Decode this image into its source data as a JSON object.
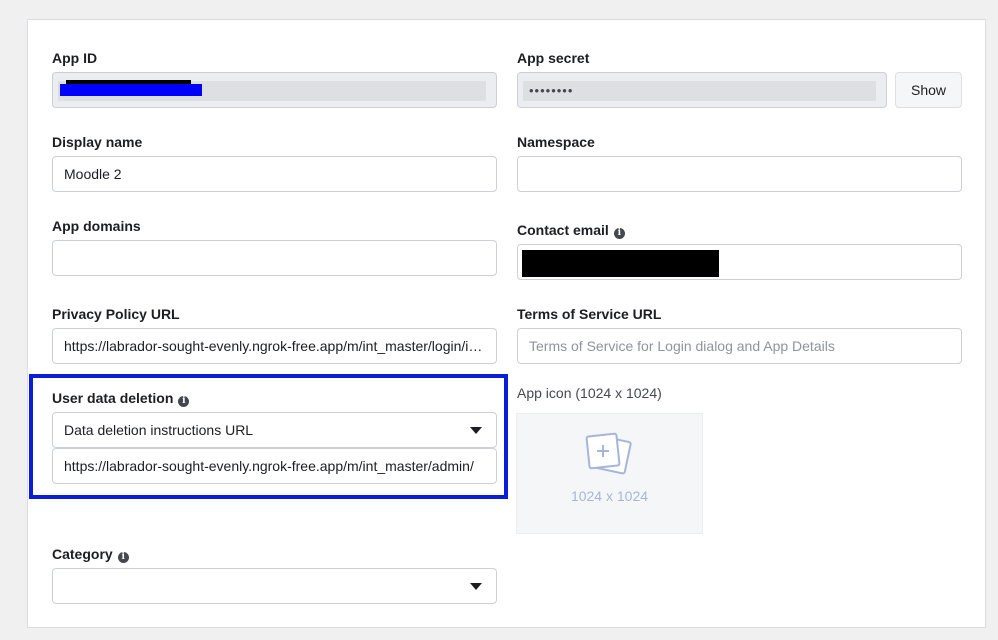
{
  "fields": {
    "app_id": {
      "label": "App ID",
      "value": ""
    },
    "app_secret": {
      "label": "App secret",
      "value": "••••••••",
      "show_button": "Show"
    },
    "display_name": {
      "label": "Display name",
      "value": "Moodle 2"
    },
    "namespace": {
      "label": "Namespace",
      "value": ""
    },
    "app_domains": {
      "label": "App domains",
      "value": ""
    },
    "contact_email": {
      "label": "Contact email",
      "value": ""
    },
    "privacy_policy_url": {
      "label": "Privacy Policy URL",
      "value": "https://labrador-sought-evenly.ngrok-free.app/m/int_master/login/index.php"
    },
    "terms_of_service_url": {
      "label": "Terms of Service URL",
      "value": "",
      "placeholder": "Terms of Service for Login dialog and App Details"
    },
    "user_data_deletion": {
      "label": "User data deletion",
      "selected_option": "Data deletion instructions URL",
      "url_value": "https://labrador-sought-evenly.ngrok-free.app/m/int_master/admin/"
    },
    "app_icon": {
      "label": "App icon (1024 x 1024)",
      "caption": "1024 x 1024"
    },
    "category": {
      "label": "Category",
      "selected_option": ""
    }
  },
  "colors": {
    "highlight_border": "#0a1dd9",
    "selection": "#0000ff",
    "redaction": "#000000"
  },
  "icons": [
    "info-icon",
    "chevron-down-icon",
    "add-image-icon"
  ]
}
